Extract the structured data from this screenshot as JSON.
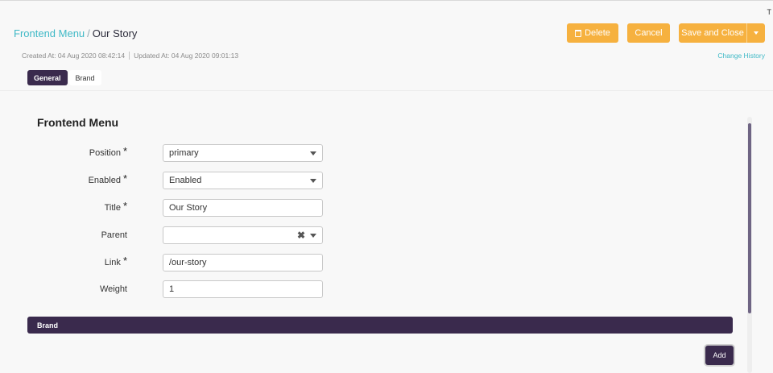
{
  "breadcrumb": {
    "parent": "Frontend Menu",
    "separator": "/",
    "current": "Our Story"
  },
  "actions": {
    "delete": "Delete",
    "cancel": "Cancel",
    "save_close": "Save and Close"
  },
  "meta": {
    "created": "Created At: 04 Aug 2020 08:42:14",
    "updated": "Updated At: 04 Aug 2020 09:01:13",
    "change_history": "Change History"
  },
  "tabs": [
    {
      "label": "General",
      "active": true
    },
    {
      "label": "Brand",
      "active": false
    }
  ],
  "section_title": "Frontend Menu",
  "form": {
    "position": {
      "label": "Position",
      "required": "*",
      "value": "primary"
    },
    "enabled": {
      "label": "Enabled",
      "required": "*",
      "value": "Enabled"
    },
    "title": {
      "label": "Title",
      "required": "*",
      "value": "Our Story"
    },
    "parent": {
      "label": "Parent",
      "value": "",
      "clear": "✖"
    },
    "link": {
      "label": "Link",
      "required": "*",
      "value": "/our-story"
    },
    "weight": {
      "label": "Weight",
      "value": "1"
    }
  },
  "brand_section": {
    "title": "Brand",
    "add_label": "Add"
  },
  "corner_mark": "T",
  "colors": {
    "accent_yellow": "#f6b13f",
    "accent_purple": "#3a2a4d",
    "link_teal": "#3fb9c6"
  },
  "icons": {
    "delete": "trash-icon",
    "dropdown": "caret-down-icon",
    "clear": "clear-x-icon"
  }
}
